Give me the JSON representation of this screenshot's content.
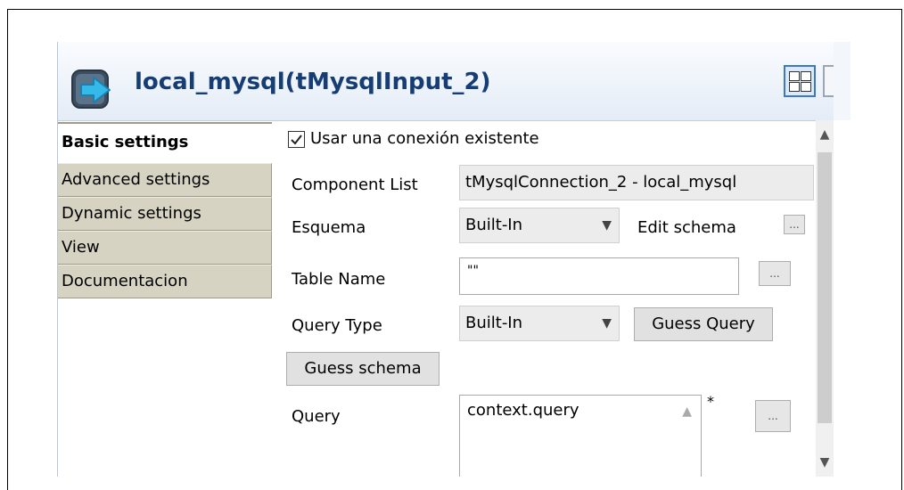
{
  "header": {
    "title": "local_mysql(tMysqlInput_2)",
    "icon": "component-arrow-icon"
  },
  "tabs": [
    {
      "label": "Basic settings",
      "active": true
    },
    {
      "label": "Advanced settings",
      "active": false
    },
    {
      "label": "Dynamic settings",
      "active": false
    },
    {
      "label": "View",
      "active": false
    },
    {
      "label": "Documentacion",
      "active": false
    }
  ],
  "form": {
    "use_existing_connection": {
      "label": "Usar una conexión existente",
      "checked": true
    },
    "component_list": {
      "label": "Component List",
      "value": "tMysqlConnection_2 - local_mysql"
    },
    "schema": {
      "label": "Esquema",
      "value": "Built-In",
      "edit_label": "Edit schema"
    },
    "table_name": {
      "label": "Table Name",
      "value": "\"\""
    },
    "query_type": {
      "label": "Query Type",
      "value": "Built-In",
      "guess_query_label": "Guess Query"
    },
    "guess_schema_label": "Guess schema",
    "query": {
      "label": "Query",
      "value": "context.query",
      "marker": "*"
    },
    "more_button_label": "..."
  },
  "colors": {
    "title": "#173e74",
    "tab_bg": "#d6d3c2",
    "icon_blue": "#3a78c8"
  }
}
